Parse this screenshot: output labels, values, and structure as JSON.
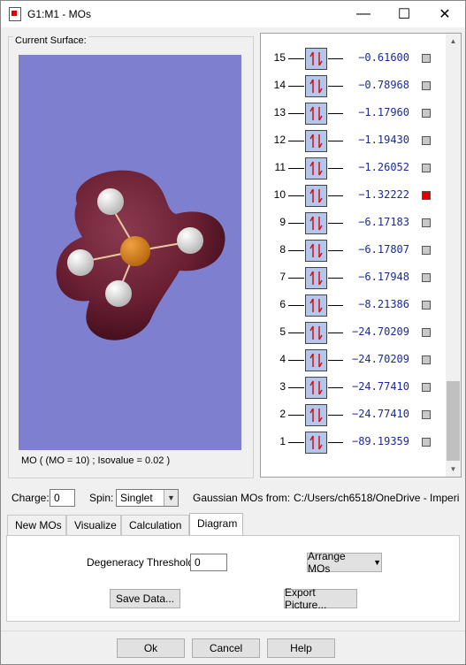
{
  "window": {
    "title": "G1:M1 - MOs",
    "controls": {
      "minimize": "—",
      "maximize": "☐",
      "close": "✕"
    }
  },
  "surface": {
    "group_label": "Current Surface:",
    "caption": "MO ( (MO = 10) ; Isovalue = 0.02 )",
    "background_color": "#7f7fcf"
  },
  "mo_diagram": {
    "orbitals": [
      {
        "number": "15",
        "energy": "−0.61600",
        "selected": false
      },
      {
        "number": "14",
        "energy": "−0.78968",
        "selected": false
      },
      {
        "number": "13",
        "energy": "−1.17960",
        "selected": false
      },
      {
        "number": "12",
        "energy": "−1.19430",
        "selected": false
      },
      {
        "number": "11",
        "energy": "−1.26052",
        "selected": false
      },
      {
        "number": "10",
        "energy": "−1.32222",
        "selected": true
      },
      {
        "number": "9",
        "energy": "−6.17183",
        "selected": false
      },
      {
        "number": "8",
        "energy": "−6.17807",
        "selected": false
      },
      {
        "number": "7",
        "energy": "−6.17948",
        "selected": false
      },
      {
        "number": "6",
        "energy": "−8.21386",
        "selected": false
      },
      {
        "number": "5",
        "energy": "−24.70209",
        "selected": false
      },
      {
        "number": "4",
        "energy": "−24.70209",
        "selected": false
      },
      {
        "number": "3",
        "energy": "−24.77410",
        "selected": false
      },
      {
        "number": "2",
        "energy": "−24.77410",
        "selected": false
      },
      {
        "number": "1",
        "energy": "−89.19359",
        "selected": false
      }
    ],
    "occupancy_symbol": "↑↓",
    "selected_color": "#e00000"
  },
  "options": {
    "charge_label": "Charge:",
    "charge_value": "0",
    "spin_label": "Spin:",
    "spin_value": "Singlet",
    "source_label": "Gaussian MOs from:",
    "source_path": "C:/Users/ch6518/OneDrive - Imperi"
  },
  "tabs": [
    {
      "label": "New MOs",
      "active": false
    },
    {
      "label": "Visualize",
      "active": false
    },
    {
      "label": "Calculation",
      "active": false
    },
    {
      "label": "Diagram",
      "active": true
    }
  ],
  "diagram_tab": {
    "degeneracy_label": "Degeneracy Threshold:",
    "degeneracy_value": "0",
    "arrange_label": "Arrange MOs",
    "save_label": "Save Data...",
    "export_label": "Export Picture..."
  },
  "footer": {
    "ok_label": "Ok",
    "cancel_label": "Cancel",
    "help_label": "Help"
  }
}
